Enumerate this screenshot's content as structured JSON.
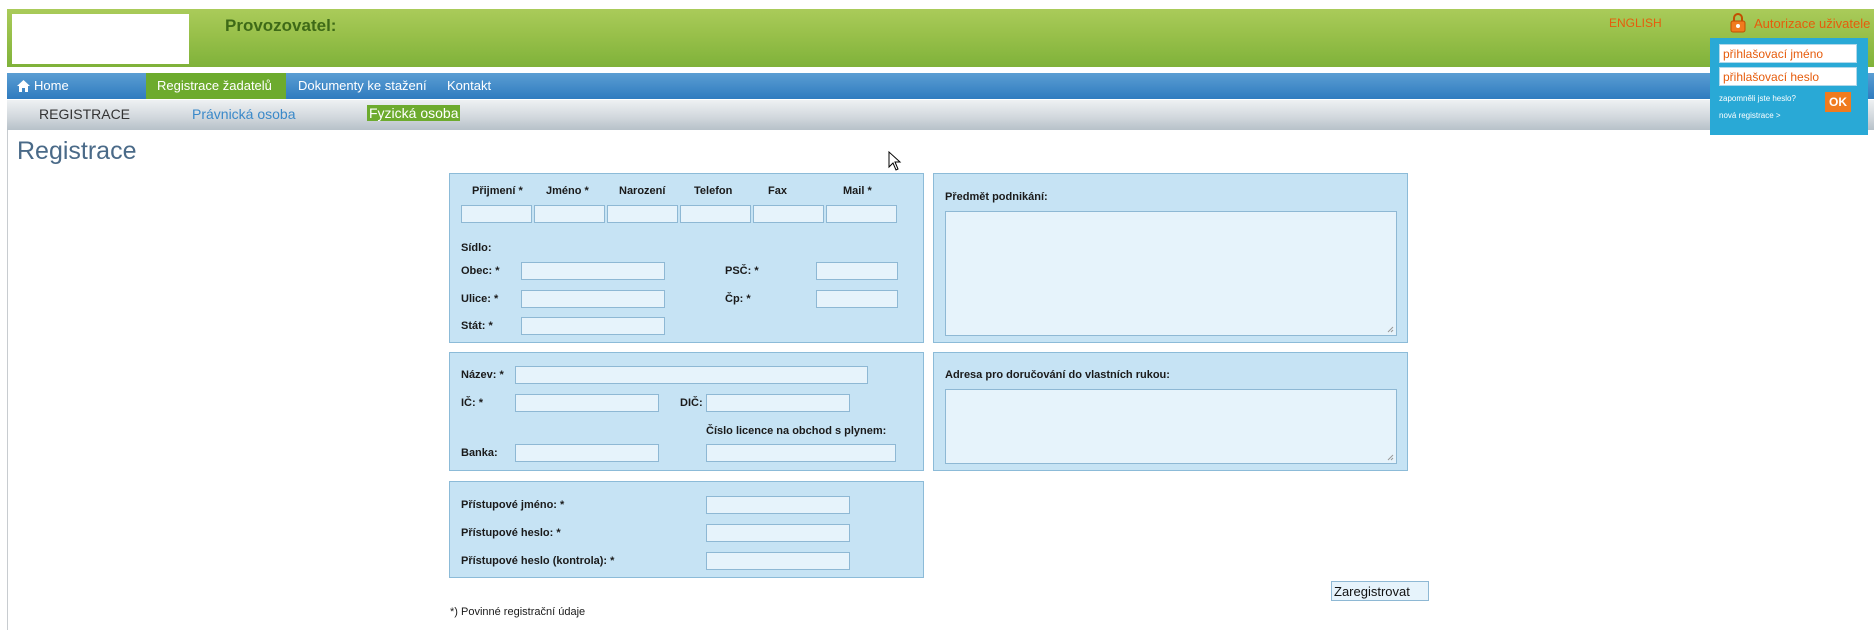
{
  "header": {
    "operator_label": "Provozovatel:",
    "language_link": "ENGLISH",
    "auth_title": "Autorizace uživatele",
    "auth_icon": "lock-icon"
  },
  "login": {
    "username_value": "přihlašovací jméno",
    "password_value": "přihlašovací heslo",
    "forgot_link": "zapomněli jste heslo?",
    "new_registration_link": "nová registrace >",
    "ok_label": "OK"
  },
  "nav": {
    "home_label": "Home",
    "home_icon": "home-icon",
    "items": [
      {
        "label": "Registrace žadatelů",
        "active": true
      },
      {
        "label": "Dokumenty ke stažení",
        "active": false
      },
      {
        "label": "Kontakt",
        "active": false
      }
    ]
  },
  "subnav": {
    "items": [
      {
        "label": "REGISTRACE",
        "active": false
      },
      {
        "label": "Právnická osoba",
        "active": false
      },
      {
        "label": "Fyzická osoba",
        "active": true
      }
    ]
  },
  "page": {
    "title": "Registrace"
  },
  "personal": {
    "columns": [
      "Přijmení *",
      "Jméno *",
      "Narození",
      "Telefon",
      "Fax",
      "Mail *"
    ]
  },
  "address": {
    "heading": "Sídlo:",
    "city_label": "Obec: *",
    "zip_label": "PSČ: *",
    "street_label": "Ulice: *",
    "number_label": "Čp: *",
    "country_label": "Stát: *"
  },
  "company": {
    "name_label": "Název: *",
    "ic_label": "IČ: *",
    "dic_label": "DIČ:",
    "license_label": "Číslo licence na obchod s plynem:",
    "bank_label": "Banka:"
  },
  "access": {
    "username_label": "Přístupové jméno: *",
    "password_label": "Přístupové heslo: *",
    "password_confirm_label": "Přístupové heslo (kontrola): *"
  },
  "business": {
    "subject_label": "Předmět podnikání:",
    "delivery_label": "Adresa pro doručování do vlastních rukou:"
  },
  "form": {
    "submit_label": "Zaregistrovat",
    "footnote": "*) Povinné registrační údaje"
  },
  "colors": {
    "header_green": "#98c04a",
    "nav_blue": "#2f7bbf",
    "active_green": "#6dab2e",
    "accent_orange": "#e65c0c",
    "form_bg": "#c6e3f4",
    "login_bg": "#29a9d6"
  }
}
